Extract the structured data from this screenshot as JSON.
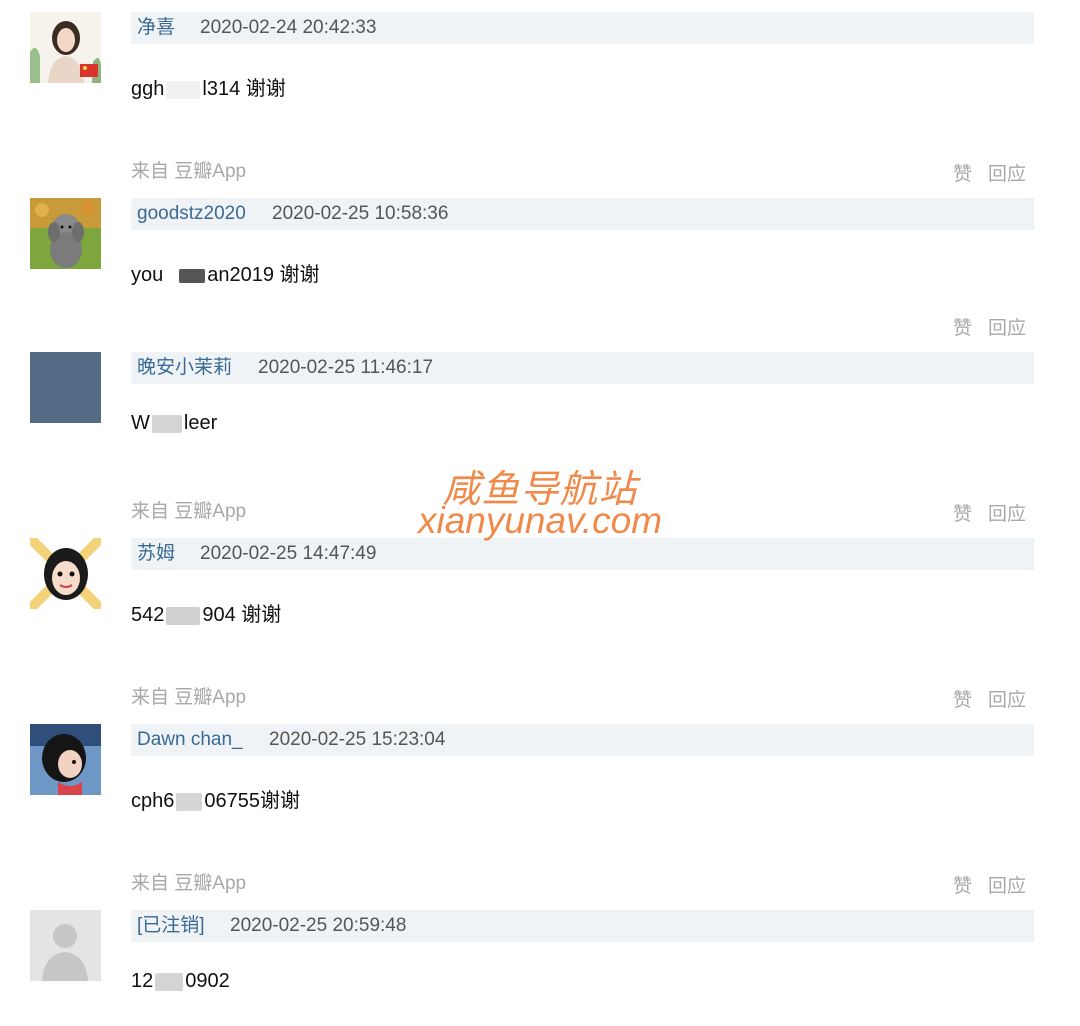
{
  "comments": [
    {
      "author": "净喜",
      "time": "2020-02-24 20:42:33",
      "content_before": "ggh",
      "content_after": "l314 谢谢",
      "source": "来自 豆瓣App",
      "like": "赞",
      "reply": "回应",
      "avatar": "illustrated-woman-avatar"
    },
    {
      "author": "goodstz2020",
      "time": "2020-02-25 10:58:36",
      "content_before": "you",
      "content_after": "an2019 谢谢",
      "source": "",
      "like": "赞",
      "reply": "回应",
      "avatar": "poodle-photo-avatar"
    },
    {
      "author": "晚安小茉莉",
      "time": "2020-02-25 11:46:17",
      "content_before": "W",
      "content_after": "leer",
      "source": "来自 豆瓣App",
      "like": "赞",
      "reply": "回应",
      "avatar": "solid-blue-avatar"
    },
    {
      "author": "苏姆",
      "time": "2020-02-25 14:47:49",
      "content_before": "542",
      "content_after": "904 谢谢",
      "source": "来自 豆瓣App",
      "like": "赞",
      "reply": "回应",
      "avatar": "cartoon-girl-avatar"
    },
    {
      "author": "Dawn chan_",
      "time": "2020-02-25 15:23:04",
      "content_before": "cph6",
      "content_after": "06755谢谢",
      "source": "来自 豆瓣App",
      "like": "赞",
      "reply": "回应",
      "avatar": "cartoon-woman-avatar"
    },
    {
      "author": "[已注销]",
      "time": "2020-02-25 20:59:48",
      "content_before": "12",
      "content_after": "0902",
      "source": "",
      "like": "",
      "reply": "",
      "avatar": "default-user-avatar"
    }
  ],
  "watermark": {
    "line1": "咸鱼导航站",
    "line2": "xianyunav.com"
  },
  "colors": {
    "author_link": "#3a6a94",
    "header_bar": "#f0f3f5",
    "muted_text": "#a8a8a8",
    "watermark": "#f08a4a"
  }
}
